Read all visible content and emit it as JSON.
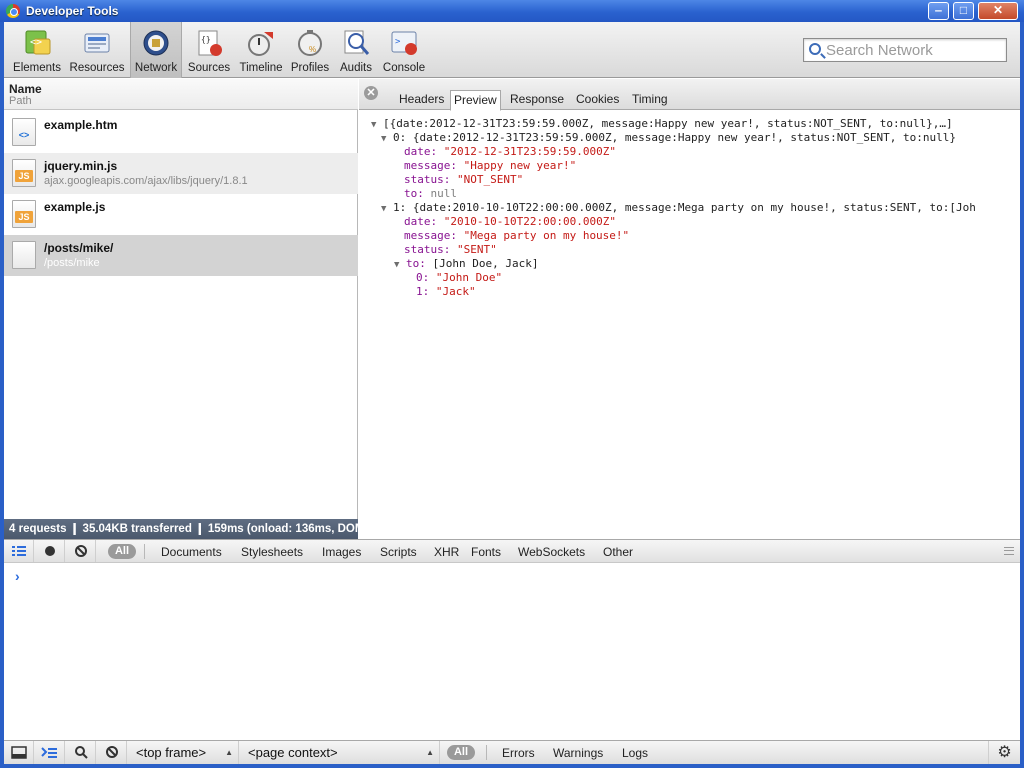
{
  "window": {
    "title": "Developer Tools",
    "minimize": "‒",
    "maximize": "□",
    "close": "✕"
  },
  "toolbar": {
    "tabs": [
      {
        "label": "Elements",
        "icon": "elements-icon"
      },
      {
        "label": "Resources",
        "icon": "resources-icon"
      },
      {
        "label": "Network",
        "icon": "network-icon",
        "selected": true
      },
      {
        "label": "Sources",
        "icon": "sources-icon"
      },
      {
        "label": "Timeline",
        "icon": "timeline-icon"
      },
      {
        "label": "Profiles",
        "icon": "profiles-icon"
      },
      {
        "label": "Audits",
        "icon": "audits-icon"
      },
      {
        "label": "Console",
        "icon": "console-icon"
      }
    ],
    "search_placeholder": "Search Network"
  },
  "network": {
    "header": {
      "name": "Name",
      "path": "Path"
    },
    "requests": [
      {
        "name": "example.htm",
        "path": "",
        "type": "html",
        "type_label": "<>"
      },
      {
        "name": "jquery.min.js",
        "path": "ajax.googleapis.com/ajax/libs/jquery/1.8.1",
        "type": "js",
        "type_label": "JS"
      },
      {
        "name": "example.js",
        "path": "",
        "type": "js",
        "type_label": "JS"
      },
      {
        "name": "/posts/mike/",
        "path": "/posts/mike",
        "type": "blank",
        "type_label": ""
      }
    ],
    "selected_request": 3,
    "summary": "4 requests  ❙  35.04KB transferred  ❙  159ms (onload: 136ms, DOM"
  },
  "detail": {
    "tabs": [
      "Headers",
      "Preview",
      "Response",
      "Cookies",
      "Timing"
    ],
    "active_tab": "Preview",
    "preview": {
      "root": "[{date:2012-12-31T23:59:59.000Z, message:Happy new year!, status:NOT_SENT, to:null},…]",
      "item0": {
        "summary": "0: {date:2012-12-31T23:59:59.000Z, message:Happy new year!, status:NOT_SENT, to:null}",
        "date": "\"2012-12-31T23:59:59.000Z\"",
        "message": "\"Happy new year!\"",
        "status": "\"NOT_SENT\"",
        "to": "null"
      },
      "item1": {
        "summary": "1: {date:2010-10-10T22:00:00.000Z, message:Mega party on my house!, status:SENT, to:[Joh",
        "date": "\"2010-10-10T22:00:00.000Z\"",
        "message": "\"Mega party on my house!\"",
        "status": "\"SENT\"",
        "to_summary": "[John Doe, Jack]",
        "to_0": "\"John Doe\"",
        "to_1": "\"Jack\""
      },
      "keys": {
        "date": "date:",
        "message": "message:",
        "status": "status:",
        "to": "to:",
        "i0": "0:",
        "i1": "1:"
      }
    }
  },
  "drawer": {
    "all_label": "All",
    "filters": [
      "Documents",
      "Stylesheets",
      "Images",
      "Scripts",
      "XHR",
      "Fonts",
      "WebSockets",
      "Other"
    ],
    "prompt": "›"
  },
  "console_bar": {
    "frame": "<top frame>",
    "context": "<page context>",
    "all_label": "All",
    "filters": [
      "Errors",
      "Warnings",
      "Logs"
    ]
  },
  "colors": {
    "accent": "#2d6cdc",
    "key": "#881391",
    "string": "#c41a16",
    "status_bar": "#55627a"
  }
}
